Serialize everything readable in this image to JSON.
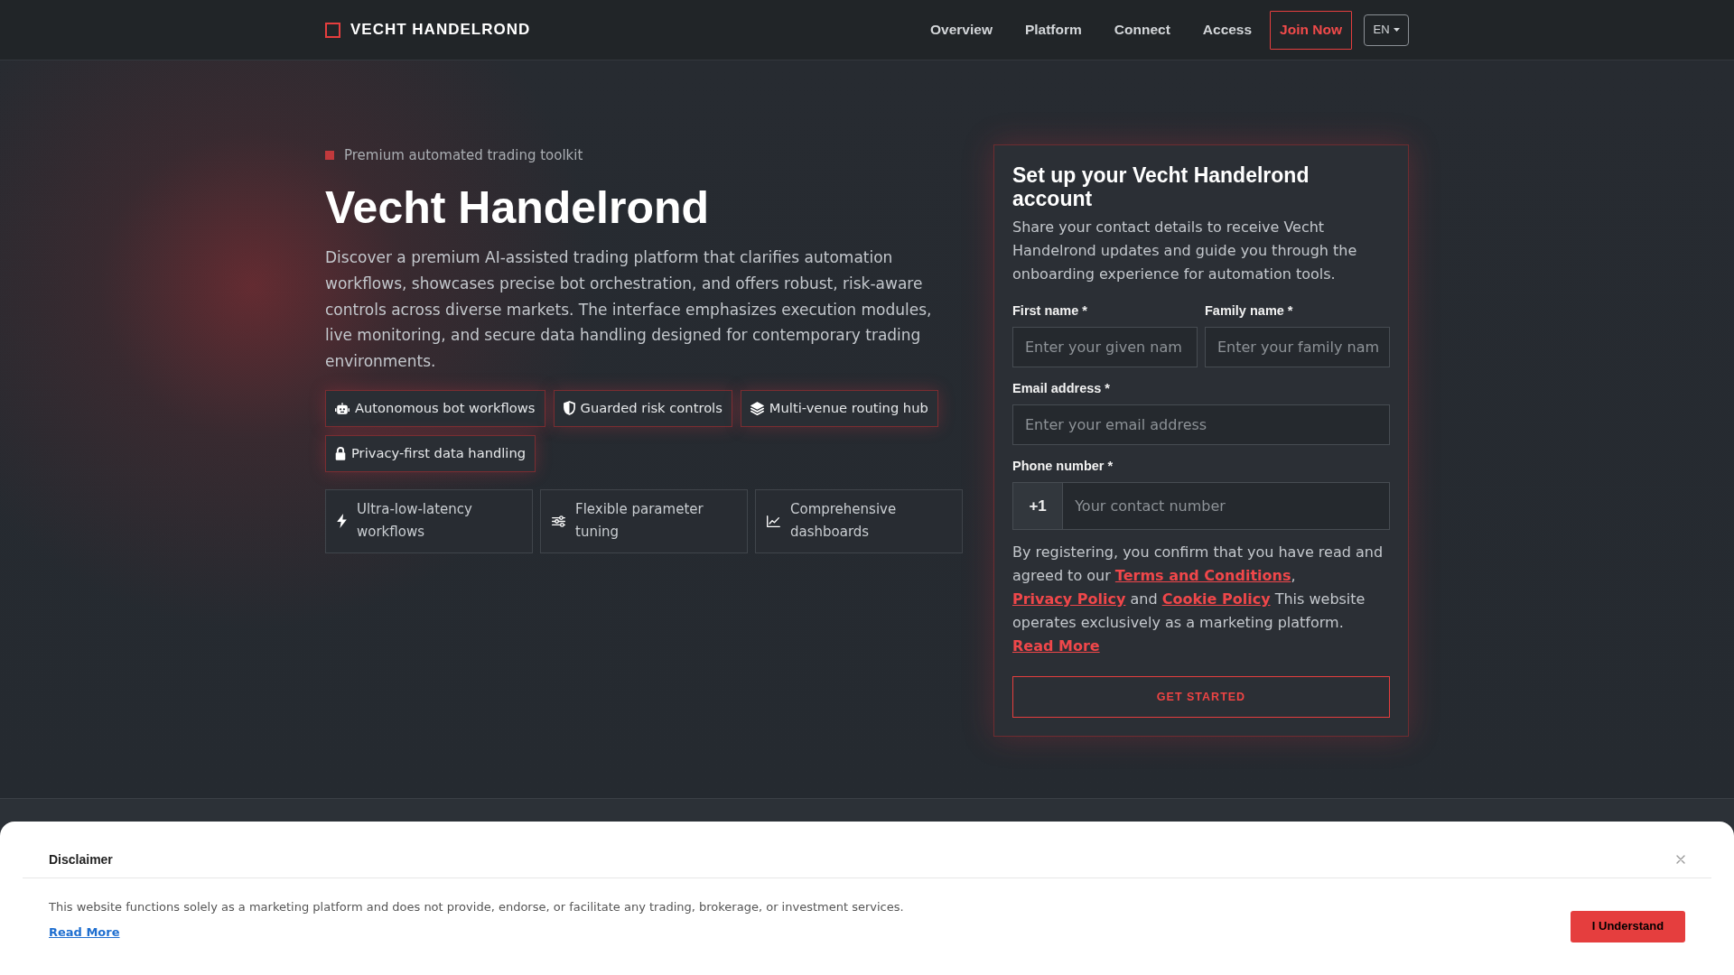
{
  "navbar": {
    "brand": "VECHT HANDELROND",
    "links": [
      {
        "label": "Overview"
      },
      {
        "label": "Platform"
      },
      {
        "label": "Connect"
      },
      {
        "label": "Access"
      }
    ],
    "join_button": "Join Now",
    "language": "EN"
  },
  "hero": {
    "eyebrow": "Premium automated trading toolkit",
    "title": "Vecht Handelrond",
    "description": "Discover a premium AI-assisted trading platform that clarifies automation workflows, showcases precise bot orchestration, and offers robust, risk-aware controls across diverse markets. The interface emphasizes execution modules, live monitoring, and secure data handling designed for contemporary trading environments.",
    "chips": [
      {
        "label": "Autonomous bot workflows"
      },
      {
        "label": "Guarded risk controls"
      },
      {
        "label": "Multi-venue routing hub"
      },
      {
        "label": "Privacy-first data handling"
      }
    ],
    "features": [
      {
        "label": "Ultra-low-latency workflows"
      },
      {
        "label": "Flexible parameter tuning"
      },
      {
        "label": "Comprehensive dashboards"
      }
    ]
  },
  "signup_form": {
    "title": "Set up your Vecht Handelrond account",
    "description": "Share your contact details to receive Vecht Handelrond updates and guide you through the onboarding experience for automation tools.",
    "fields": [
      {
        "kind": "text",
        "label": "First name *",
        "placeholder": "Enter your given nam"
      },
      {
        "kind": "text",
        "label": "Family name *",
        "placeholder": "Enter your family nam"
      },
      {
        "kind": "email",
        "label": "Email address *",
        "placeholder": "Enter your email address"
      },
      {
        "kind": "phone",
        "label": "Phone number *",
        "prefix": "+1",
        "placeholder": "Your contact number"
      }
    ],
    "consent": [
      {
        "kind": "text",
        "text": "By registering, you confirm that you have read and agreed to our "
      },
      {
        "kind": "link",
        "text": "Terms and Conditions"
      },
      {
        "kind": "text",
        "text": ", "
      },
      {
        "kind": "link",
        "text": "Privacy Policy"
      },
      {
        "kind": "text",
        "text": " and "
      },
      {
        "kind": "link",
        "text": "Cookie Policy"
      },
      {
        "kind": "text",
        "text": " This website operates exclusively as a marketing platform. "
      },
      {
        "kind": "link",
        "text": "Read More"
      }
    ],
    "submit": "GET STARTED"
  },
  "disclaimer": {
    "title": "Disclaimer",
    "text": "This website functions solely as a marketing platform and does not provide, endorse, or facilitate any trading, brokerage, or investment services.",
    "link": "Read More",
    "button": "I Understand"
  }
}
